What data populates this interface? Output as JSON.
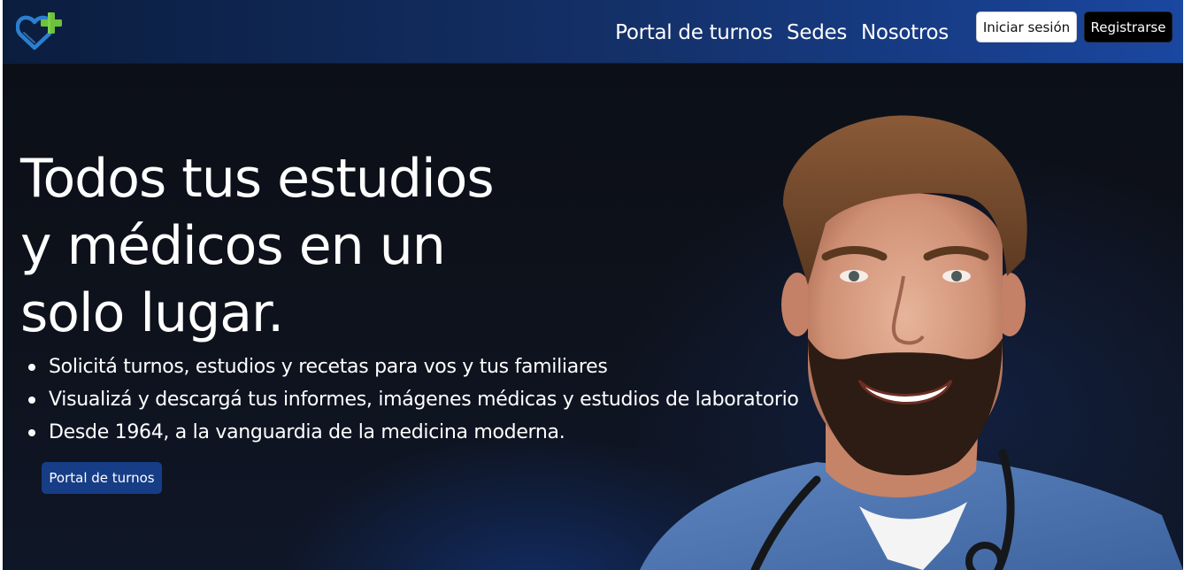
{
  "navbar": {
    "logo_icon": "heart-plus-icon",
    "links": [
      "Portal de turnos",
      "Sedes",
      "Nosotros"
    ],
    "login_label": "Iniciar sesión",
    "register_label": "Registrarse"
  },
  "hero": {
    "headline_lines": [
      "Todos tus estudios",
      "y médicos en un",
      "solo lugar."
    ],
    "bullets": [
      "Solicitá turnos, estudios y recetas para vos y tus familiares",
      "Visualizá y descargá tus informes, imágenes médicas y estudios de laboratorio",
      "Desde 1964, a la vanguardia de la medicina moderna."
    ],
    "cta_label": "Portal de turnos",
    "image": "smiling-doctor-photo"
  },
  "colors": {
    "nav_bg_start": "#0b1d3e",
    "nav_bg_end": "#1a47a0",
    "hero_bg": "#0e121c",
    "cta_bg": "#163d86",
    "logo_heart": "#2b7fd0",
    "logo_cross": "#6cc23a"
  }
}
